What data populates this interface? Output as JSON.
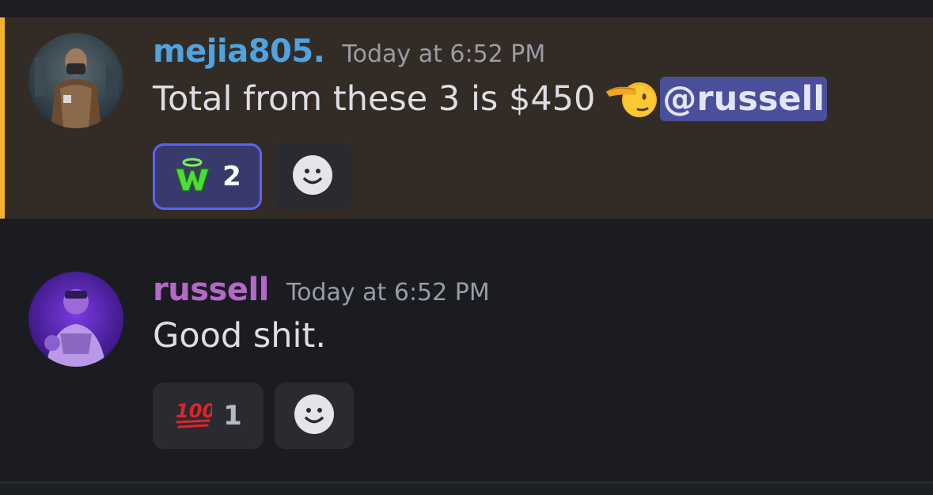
{
  "colors": {
    "background": "#1b1c22",
    "highlight_background": "#332c26",
    "mention_bar": "#f0b232",
    "mention_pill": "#4a4f9c",
    "own_reaction_border": "#5865f2",
    "username_mejia": "#4fa3e0",
    "username_russell": "#b568c9",
    "timestamp": "#9a9ca3"
  },
  "messages": [
    {
      "author": "mejia805.",
      "timestamp": "Today at 6:52 PM",
      "text": "Total from these 3 is $450",
      "inline_emoji": "saluting-face-emoji",
      "mention": "@russell",
      "highlighted": true,
      "reactions": [
        {
          "emoji": "winged-w-emoji",
          "count": "2",
          "reacted_by_me": true
        }
      ],
      "add_reaction_icon": "smiley-icon"
    },
    {
      "author": "russell",
      "timestamp": "Today at 6:52 PM",
      "text": "Good shit.",
      "highlighted": false,
      "reactions": [
        {
          "emoji": "hundred-points-emoji",
          "count": "1",
          "reacted_by_me": false
        }
      ],
      "add_reaction_icon": "smiley-icon"
    }
  ]
}
